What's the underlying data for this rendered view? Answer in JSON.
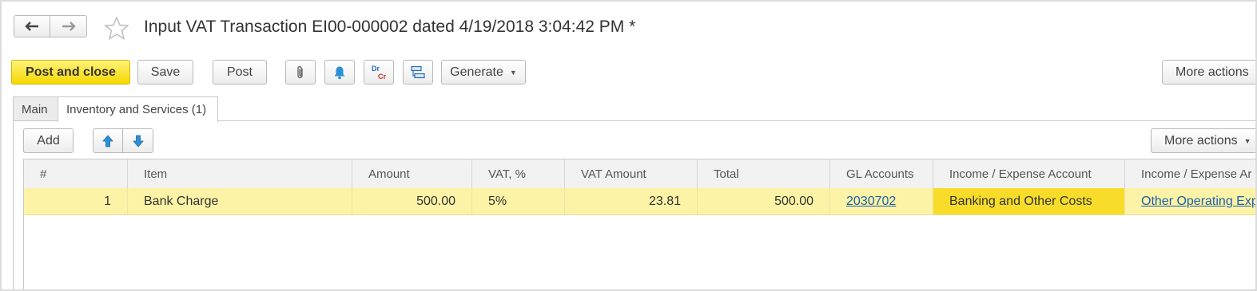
{
  "header": {
    "back_icon": "arrow-left-icon",
    "forward_icon": "arrow-right-icon",
    "favorite_icon": "star-icon",
    "title": "Input VAT Transaction EI00-000002 dated 4/19/2018 3:04:42 PM *"
  },
  "toolbar": {
    "post_and_close": "Post and close",
    "save": "Save",
    "post": "Post",
    "attach_icon": "paperclip-icon",
    "reminder_icon": "bell-icon",
    "dr": "Dr",
    "cr": "Cr",
    "structure_icon": "document-structure-icon",
    "generate": "Generate",
    "more_actions": "More actions"
  },
  "tabs": [
    {
      "label": "Main"
    },
    {
      "label": "Inventory and Services (1)"
    }
  ],
  "table_toolbar": {
    "add": "Add",
    "move_up_icon": "arrow-up-icon",
    "move_down_icon": "arrow-down-icon",
    "more_actions": "More actions"
  },
  "table": {
    "columns": [
      "#",
      "Item",
      "Amount",
      "VAT, %",
      "VAT Amount",
      "Total",
      "GL Accounts",
      "Income / Expense Account",
      "Income / Expense Ar"
    ],
    "rows": [
      {
        "num": "1",
        "item": "Bank Charge",
        "amount": "500.00",
        "vat_pct": "5%",
        "vat_amount": "23.81",
        "total": "500.00",
        "gl_accounts": "2030702",
        "income_expense_account": "Banking and Other Costs",
        "income_expense_analytics": "Other Operating Exp"
      }
    ]
  },
  "colors": {
    "primary_button": "#f5d800",
    "selected_row": "#fcf3a6",
    "selected_cell": "#f8dc2a",
    "link": "#1f5fa8"
  }
}
